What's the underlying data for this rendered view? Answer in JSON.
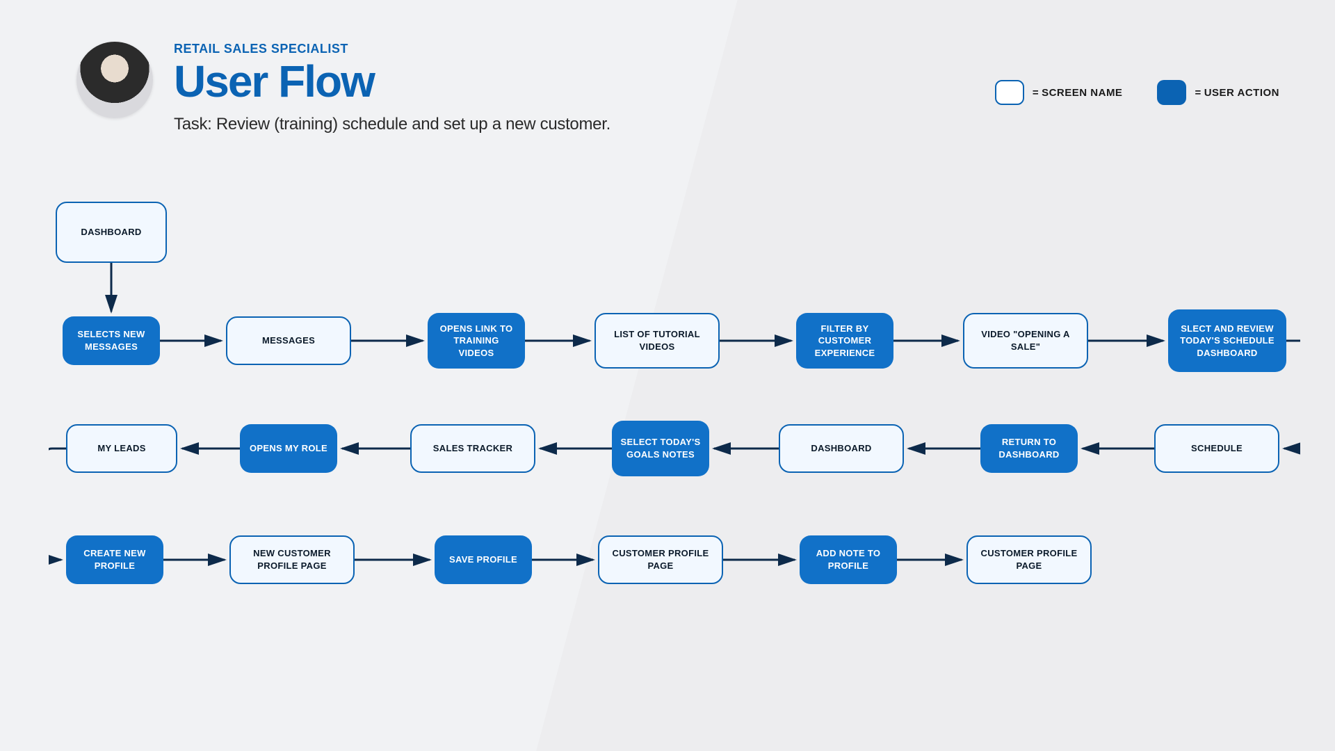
{
  "header": {
    "role": "RETAIL SALES SPECIALIST",
    "title": "User Flow",
    "task": "Task: Review (training) schedule and set up a new customer."
  },
  "legend": {
    "screen": "SCREEN NAME",
    "action": "USER ACTION"
  },
  "nodes": {
    "dashboard0": "DASHBOARD",
    "selects_new_messages": "SELECTS NEW MESSAGES",
    "messages": "MESSAGES",
    "opens_link": "OPENS LINK TO TRAINING VIDEOS",
    "list_videos": "LIST OF TUTORIAL VIDEOS",
    "filter_by": "FILTER BY CUSTOMER EXPERIENCE",
    "video_opening": "VIDEO \"OPENING A SALE\"",
    "select_review": "SLECT AND REVIEW TODAY'S SCHEDULE DASHBOARD",
    "schedule": "SCHEDULE",
    "return_dash": "RETURN TO DASHBOARD",
    "dashboard2": "DASHBOARD",
    "select_goals": "SELECT TODAY'S GOALS NOTES",
    "sales_tracker": "SALES TRACKER",
    "opens_role": "OPENS MY ROLE",
    "my_leads": "MY LEADS",
    "create_profile": "CREATE NEW PROFILE",
    "new_customer": "NEW CUSTOMER PROFILE PAGE",
    "save_profile": "SAVE PROFILE",
    "customer_page1": "CUSTOMER PROFILE PAGE",
    "add_note": "ADD NOTE TO PROFILE",
    "customer_page2": "CUSTOMER PROFILE PAGE"
  }
}
